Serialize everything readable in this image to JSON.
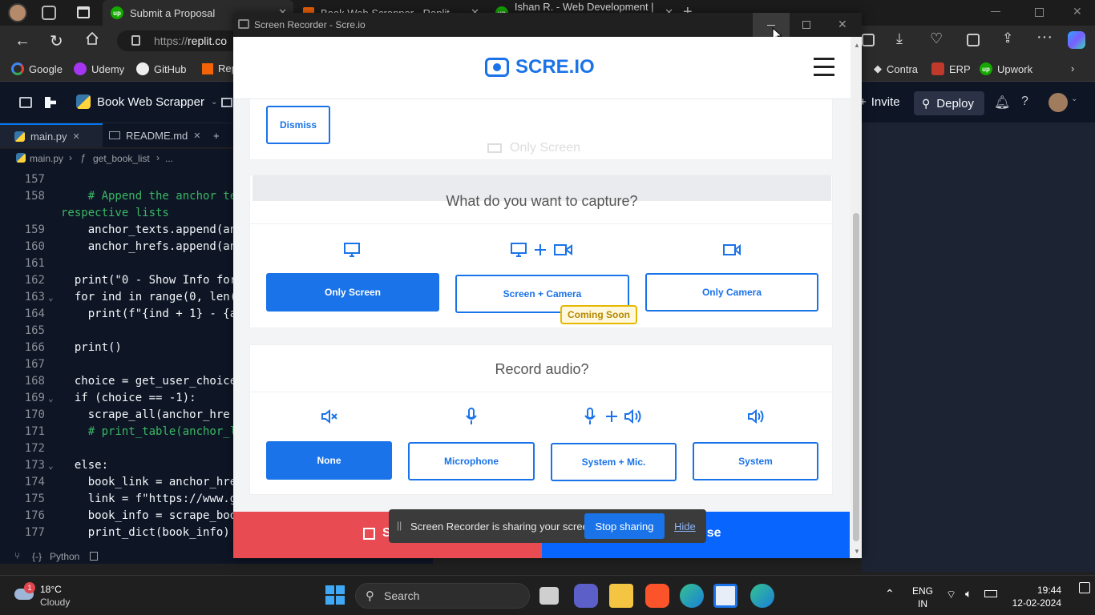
{
  "browser": {
    "tabs": [
      {
        "title": "Submit a Proposal"
      },
      {
        "title": "Book Web Scrapper - Replit"
      },
      {
        "title": "Ishan R. - Web Development | R..."
      }
    ],
    "url_prefix": "https://",
    "url_host": "replit.co",
    "bookmarks": [
      "Google",
      "Udemy",
      "GitHub",
      "Rep",
      "Contra",
      "ERP",
      "Upwork"
    ]
  },
  "replit": {
    "project_name": "Book Web Scrapper",
    "invite_label": "Invite",
    "deploy_label": "Deploy",
    "file_tabs": [
      "main.py",
      "README.md"
    ],
    "breadcrumb": [
      "main.py",
      "get_book_list",
      "..."
    ],
    "status_language": "Python",
    "code_lines": [
      {
        "n": "157",
        "text": ""
      },
      {
        "n": "158",
        "text": "    # Append the anchor te"
      },
      {
        "n": "",
        "text": "respective lists"
      },
      {
        "n": "159",
        "text": "    anchor_texts.append(an"
      },
      {
        "n": "160",
        "text": "    anchor_hrefs.append(an"
      },
      {
        "n": "161",
        "text": ""
      },
      {
        "n": "162",
        "text": "  print(\"0 - Show Info for"
      },
      {
        "n": "163",
        "text": "  for ind in range(0, len("
      },
      {
        "n": "164",
        "text": "    print(f\"{ind + 1} - {a"
      },
      {
        "n": "165",
        "text": ""
      },
      {
        "n": "166",
        "text": "  print()"
      },
      {
        "n": "167",
        "text": ""
      },
      {
        "n": "168",
        "text": "  choice = get_user_choice"
      },
      {
        "n": "169",
        "text": "  if (choice == -1):"
      },
      {
        "n": "170",
        "text": "    scrape_all(anchor_hre"
      },
      {
        "n": "171",
        "text": "    # print_table(anchor_l"
      },
      {
        "n": "172",
        "text": ""
      },
      {
        "n": "173",
        "text": "  else:"
      },
      {
        "n": "174",
        "text": "    book_link = anchor_hre"
      },
      {
        "n": "175",
        "text": "    link = f\"https://www.g"
      },
      {
        "n": "176",
        "text": "    book_info = scrape_boo"
      },
      {
        "n": "177",
        "text": "    print_dict(book_info)"
      }
    ]
  },
  "recorder": {
    "window_title": "Screen Recorder - Scre.io",
    "logo_text": "SCRE.IO",
    "dismiss_label": "Dismiss",
    "ghost_text": "Only Screen",
    "capture_question": "What do you want to capture?",
    "capture_options": [
      "Only Screen",
      "Screen + Camera",
      "Only Camera"
    ],
    "capture_selected": "Only Screen",
    "coming_soon_badge": "Coming Soon",
    "audio_question": "Record audio?",
    "audio_options": [
      "None",
      "Microphone",
      "System + Mic.",
      "System"
    ],
    "audio_selected": "None",
    "start_label_partial": "S",
    "pause_label_partial": "use",
    "colors": {
      "primary": "#1a73e8",
      "danger": "#e94b52",
      "bottom_blue": "#0866ff",
      "badge": "#e6b800"
    }
  },
  "share_bar": {
    "message": "Screen Recorder is sharing your screen.",
    "stop_label": "Stop sharing",
    "hide_label": "Hide"
  },
  "taskbar": {
    "weather_temp": "18°C",
    "weather_desc": "Cloudy",
    "weather_badge": "1",
    "search_label": "Search",
    "lang_1": "ENG",
    "lang_2": "IN",
    "time": "19:44",
    "date": "12-02-2024"
  }
}
